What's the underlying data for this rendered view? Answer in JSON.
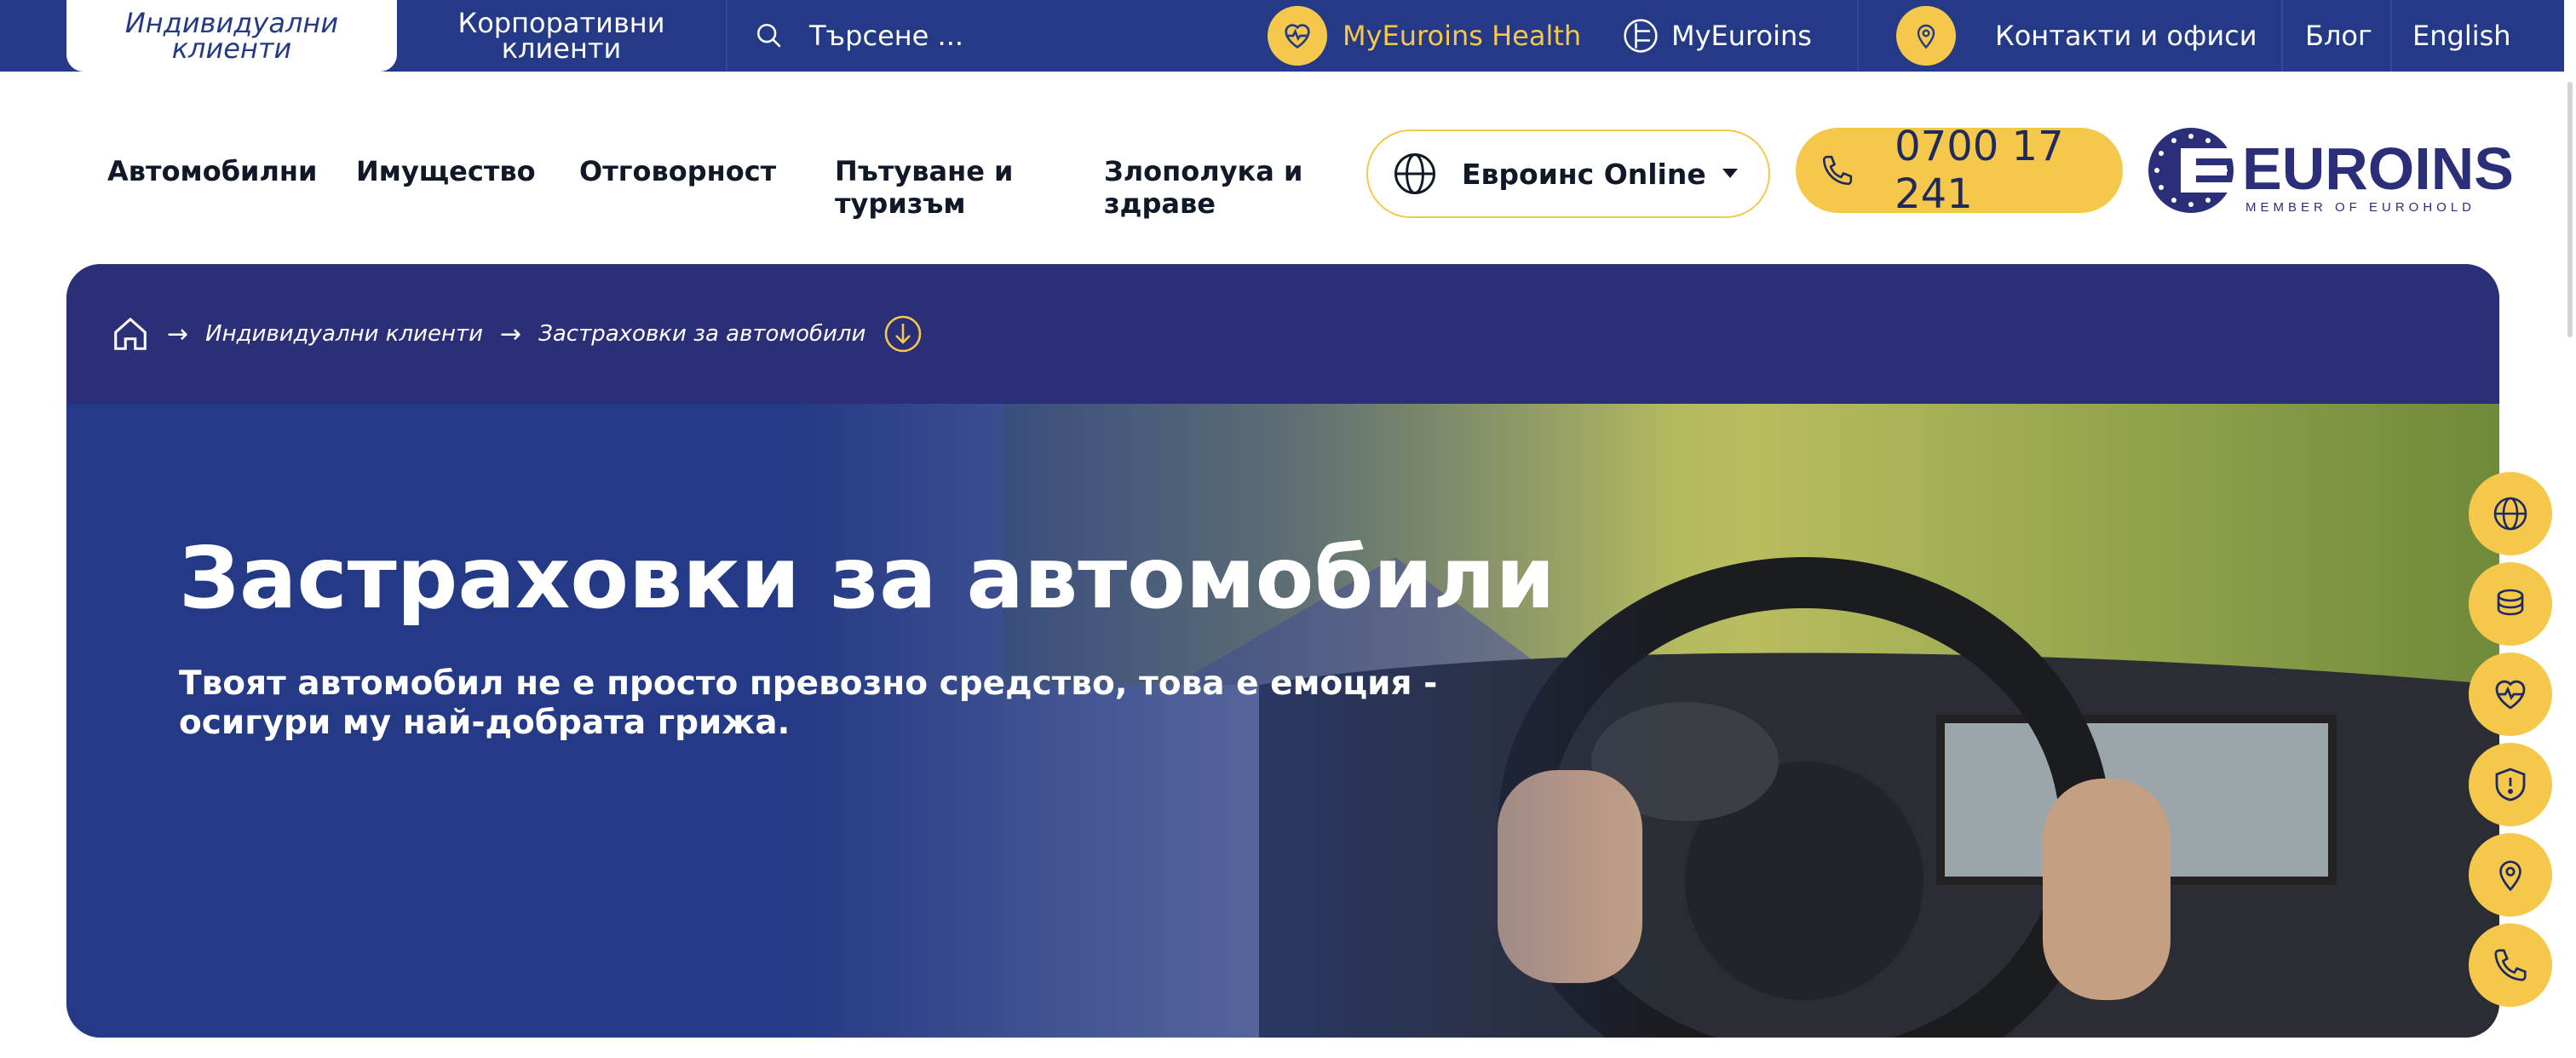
{
  "topbar": {
    "tab_individual": "Индивидуални клиенти",
    "tab_corporate": "Корпоративни клиенти",
    "search_placeholder": "Търсене ...",
    "myeuroins_health": "MyEuroins Health",
    "myeuroins": "MyEuroins",
    "contacts": "Контакти и офиси",
    "blog": "Блог",
    "english": "English"
  },
  "nav": {
    "items": [
      "Автомобилни",
      "Имущество",
      "Отговорност",
      "Пътуване и туризъм",
      "Злополука и здраве"
    ],
    "online_label": "Евроинс Online",
    "phone": "0700 17 241"
  },
  "logo": {
    "name": "EUROINS",
    "tagline": "MEMBER OF EUROHOLD"
  },
  "breadcrumb": {
    "items": [
      "Индивидуални клиенти",
      "Застраховки за автомобили"
    ]
  },
  "hero": {
    "title": "Застраховки за автомобили",
    "subtitle": "Твоят автомобил не е просто превозно средство, това е емоция - осигури му най-добрата грижа."
  },
  "floating_buttons": [
    "globe-icon",
    "coins-icon",
    "heart-pulse-icon",
    "shield-alert-icon",
    "location-pin-icon",
    "phone-icon"
  ],
  "colors": {
    "navy": "#253a86",
    "yellow": "#f5c84c",
    "breadcrumb_bg": "#2a2f78",
    "health_text": "#f5c84c"
  }
}
